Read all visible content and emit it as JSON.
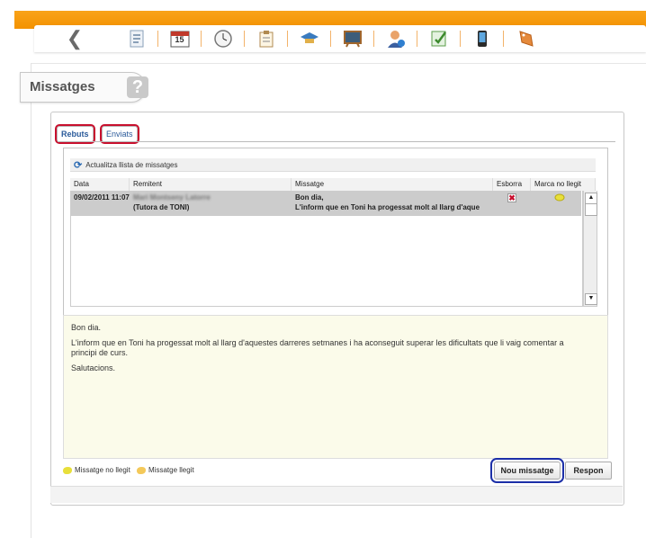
{
  "page": {
    "title": "Missatges",
    "help_label": "?"
  },
  "toolbar": {
    "back_label": "❮",
    "icons": [
      "document-icon",
      "calendar-icon",
      "clock-icon",
      "clipboard-icon",
      "graduation-icon",
      "board-icon",
      "user-info-icon",
      "certificate-icon",
      "phone-icon",
      "tag-icon"
    ],
    "calendar_day": "15"
  },
  "tabs": [
    {
      "label": "Rebuts",
      "active": true
    },
    {
      "label": "Enviats",
      "active": false
    }
  ],
  "inbox": {
    "refresh_label": "Actualitza llista de missatges",
    "columns": {
      "date": "Data",
      "sender": "Remitent",
      "message": "Missatge",
      "delete": "Esborra",
      "mark": "Marca no llegit"
    },
    "rows": [
      {
        "date": "09/02/2011 11:07",
        "sender_name": "Mari Montseny Latorre",
        "sender_role": "(Tutora de TONI)",
        "message_line1": "Bon dia,",
        "message_line2": "L'inform que en Toni  ha progessat molt al llarg d'aque",
        "delete_icon": "✖",
        "mark_icon": "mark-unread-icon"
      }
    ]
  },
  "preview": {
    "line1": "Bon dia.",
    "line2": "L'inform que en Toni  ha progessat molt al llarg d'aquestes darreres setmanes i ha aconseguit superar les dificultats que li vaig comentar a",
    "line3": "principi de curs.",
    "line4": "Salutacions."
  },
  "legend": {
    "unread": "Missatge no llegit",
    "read": "Missatge llegit"
  },
  "buttons": {
    "new_message": "Nou missatge",
    "reply": "Respon"
  },
  "colors": {
    "accent": "#f39200",
    "link": "#2a5a9a",
    "selected_row": "#cccccc",
    "preview_bg": "#fbfbea"
  }
}
